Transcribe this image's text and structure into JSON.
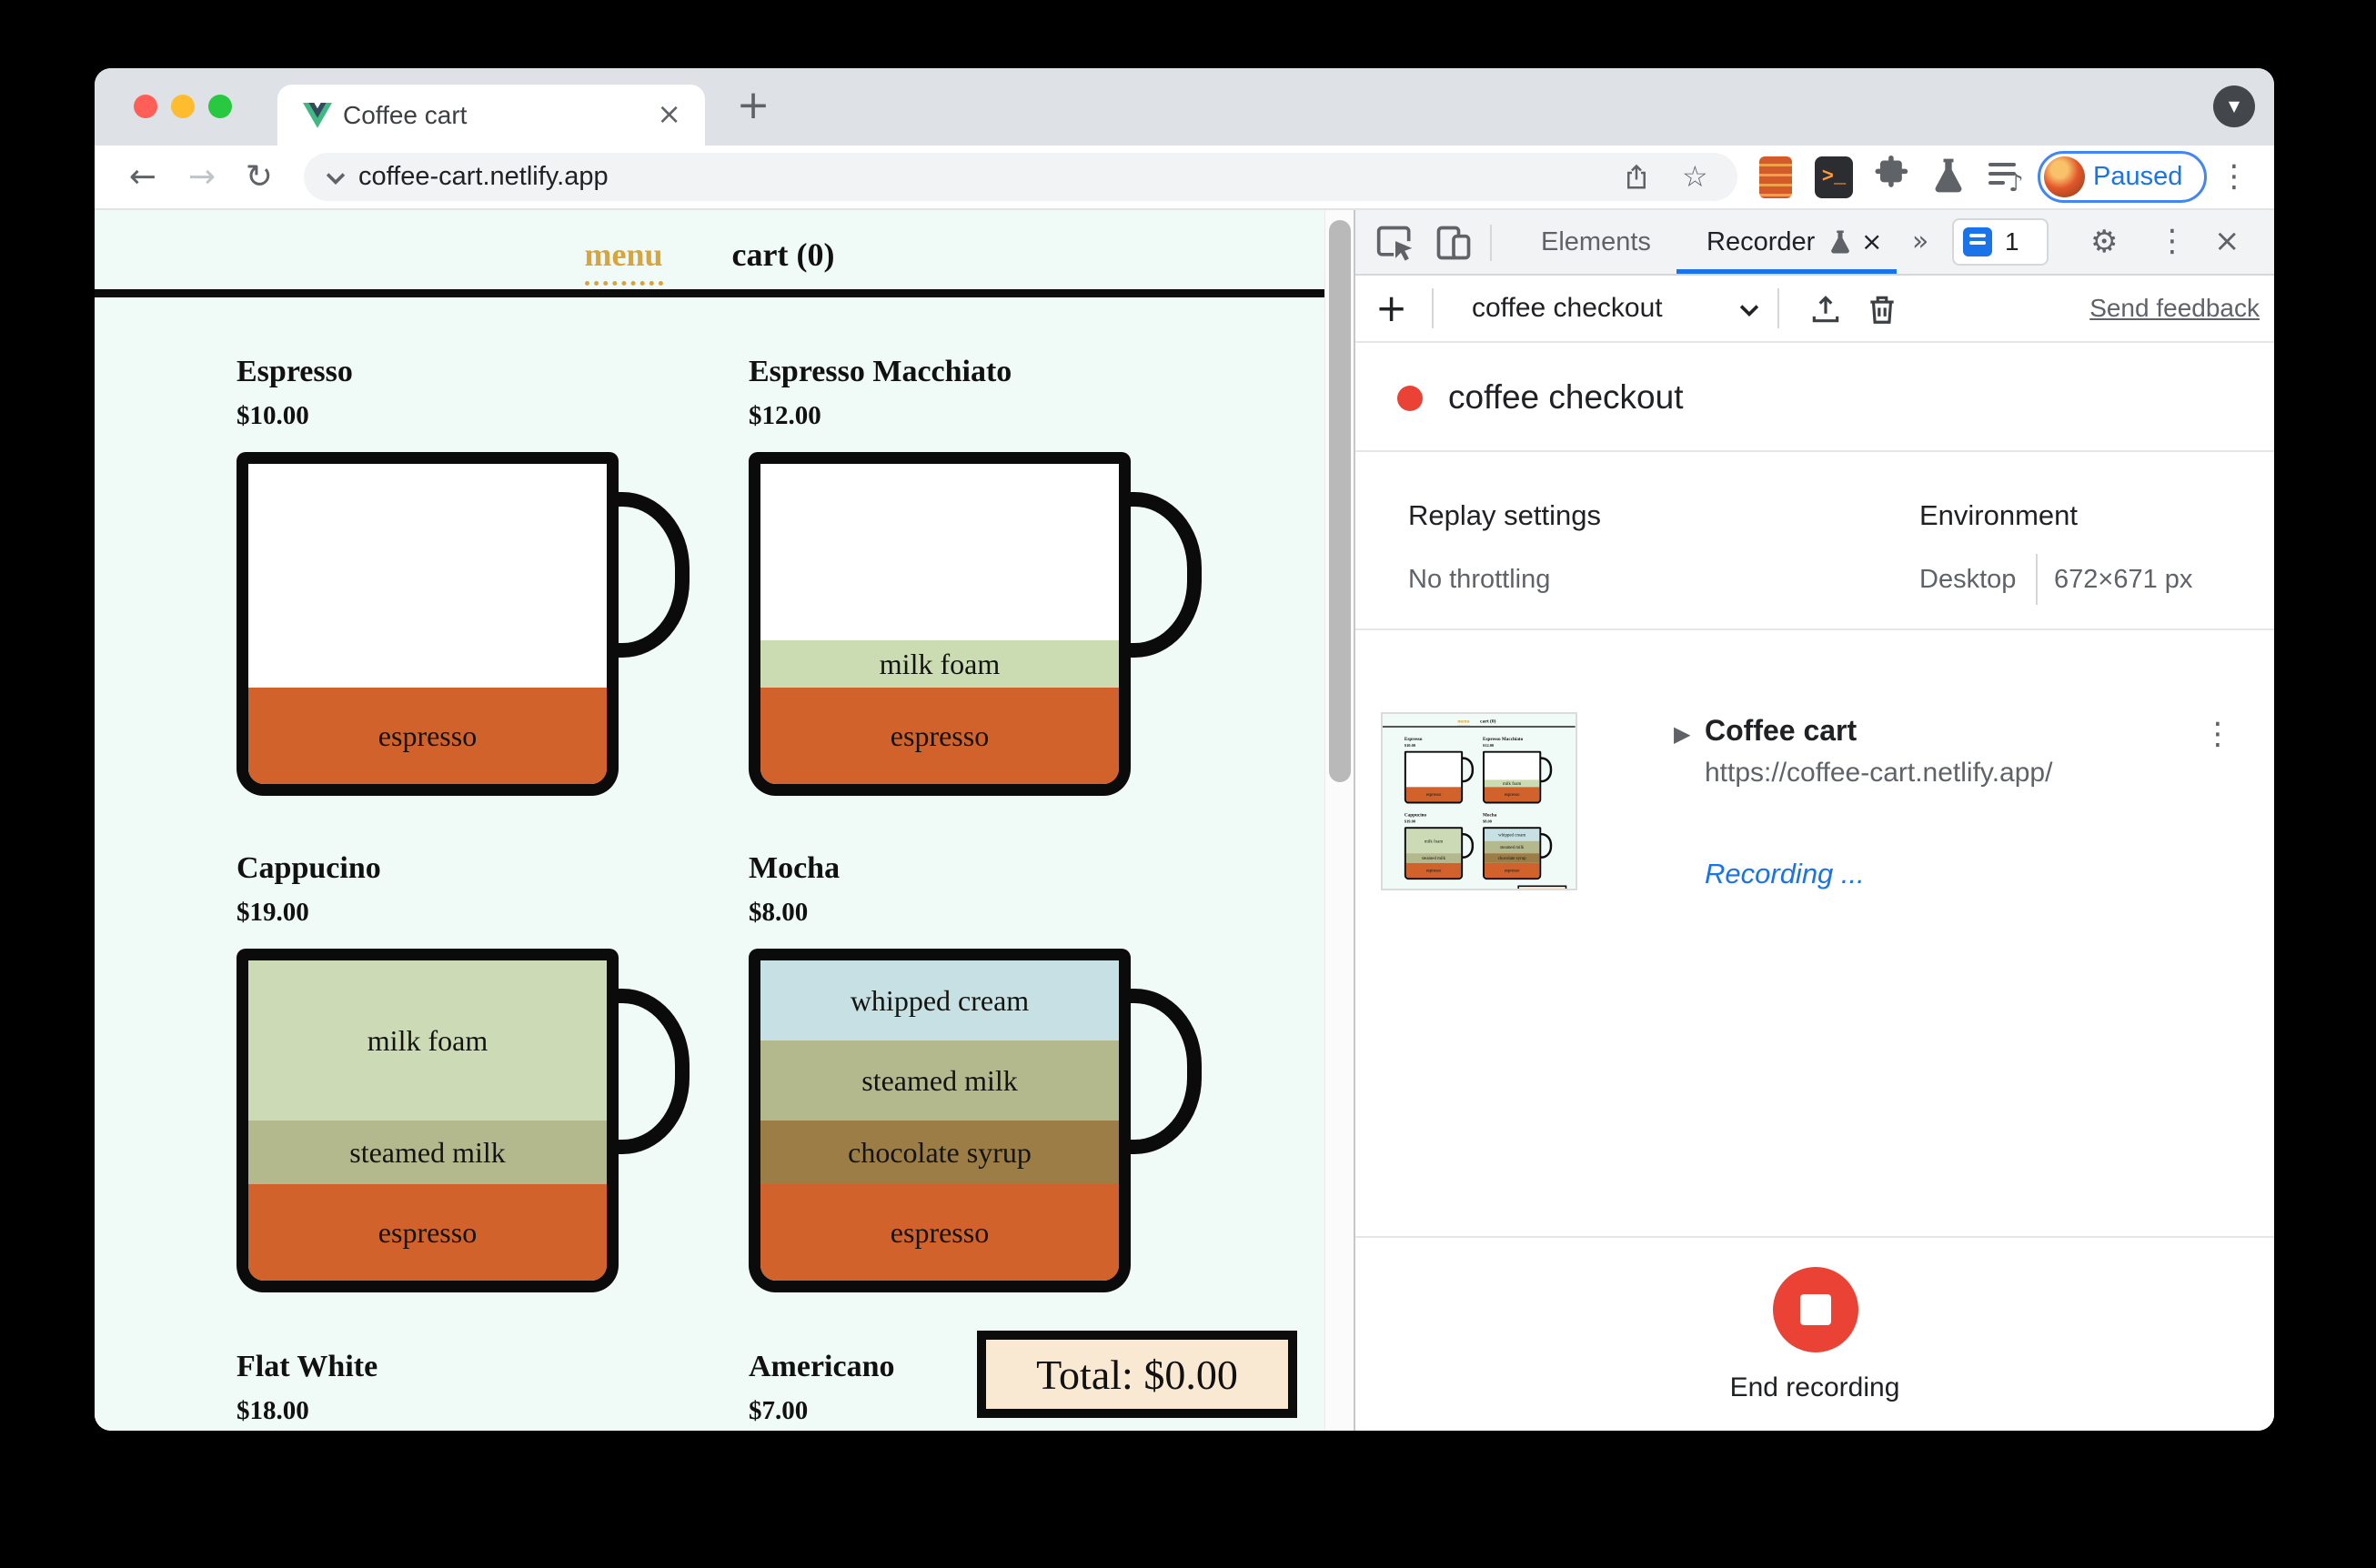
{
  "browser": {
    "tab_title": "Coffee cart",
    "url": "coffee-cart.netlify.app",
    "profile_status": "Paused"
  },
  "glyphs": {
    "back": "←",
    "forward": "→",
    "reload": "↻",
    "star": "☆",
    "kebab": "⋮",
    "more_tabs": "»",
    "caret_down": "▼",
    "disclosure": "▶",
    "gear": "⚙",
    "note": "♪",
    "close": "×",
    "plus": "+",
    "terminal_prompt": ">_"
  },
  "app": {
    "nav": {
      "menu": "menu",
      "cart": "cart (0)"
    },
    "total": "Total: $0.00",
    "items": [
      {
        "name": "Espresso",
        "price": "$10.00",
        "cup": true,
        "layers": [
          {
            "label": "espresso",
            "color": "#d2622b",
            "pct": 30
          }
        ]
      },
      {
        "name": "Espresso Macchiato",
        "price": "$12.00",
        "cup": true,
        "layers": [
          {
            "label": "milk foam",
            "color": "#cbdcb2",
            "pct": 15
          },
          {
            "label": "espresso",
            "color": "#d2622b",
            "pct": 30
          }
        ]
      },
      {
        "name": "Cappucino",
        "price": "$19.00",
        "cup": true,
        "layers": [
          {
            "label": "milk foam",
            "color": "#ccdbb5",
            "pct": 50
          },
          {
            "label": "steamed milk",
            "color": "#b4b88d",
            "pct": 20
          },
          {
            "label": "espresso",
            "color": "#d2622b",
            "pct": 30
          }
        ]
      },
      {
        "name": "Mocha",
        "price": "$8.00",
        "cup": true,
        "layers": [
          {
            "label": "whipped cream",
            "color": "#c6e0e3",
            "pct": 25
          },
          {
            "label": "steamed milk",
            "color": "#b4b88d",
            "pct": 25
          },
          {
            "label": "chocolate syrup",
            "color": "#9c7d45",
            "pct": 20
          },
          {
            "label": "espresso",
            "color": "#d2622b",
            "pct": 30
          }
        ]
      },
      {
        "name": "Flat White",
        "price": "$18.00",
        "cup": false,
        "layers": []
      },
      {
        "name": "Americano",
        "price": "$7.00",
        "cup": false,
        "layers": []
      }
    ]
  },
  "devtools": {
    "tabs": {
      "elements": "Elements",
      "recorder": "Recorder",
      "badge_count": "1"
    },
    "controls": {
      "recording_name": "coffee checkout",
      "send_feedback": "Send feedback"
    },
    "heading": "coffee checkout",
    "replay": {
      "title": "Replay settings",
      "value": "No throttling"
    },
    "environment": {
      "title": "Environment",
      "device": "Desktop",
      "viewport": "672×671 px"
    },
    "step": {
      "title": "Coffee cart",
      "url": "https://coffee-cart.netlify.app/",
      "status": "Recording ..."
    },
    "footer": {
      "end_recording": "End recording"
    }
  },
  "colors": {
    "accent_blue": "#1a73e8",
    "record_red": "#ea4335",
    "menu_gold": "#d9a43b",
    "espresso": "#d2622b",
    "total_bg": "#f9e8d2",
    "page_bg": "#f0faf7",
    "traffic_close": "#ff5f57",
    "traffic_min": "#febc2e",
    "traffic_max": "#28c840"
  }
}
